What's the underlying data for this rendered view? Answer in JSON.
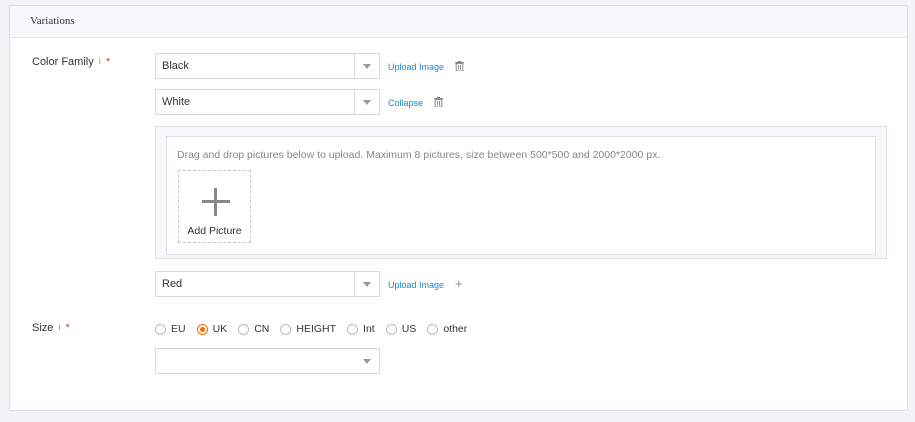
{
  "section": {
    "title": "Variations"
  },
  "color_family": {
    "label": "Color Family",
    "info_icon": "i",
    "required": "*",
    "colors": [
      {
        "value": "Black",
        "action": "Upload Image"
      },
      {
        "value": "White",
        "action": "Collapse"
      },
      {
        "value": "Red",
        "action": "Upload Image"
      }
    ],
    "upload": {
      "hint": "Drag and drop pictures below to upload. Maximum 8 pictures, size between 500*500 and 2000*2000 px.",
      "add_label": "Add Picture"
    }
  },
  "size": {
    "label": "Size",
    "info_icon": "i",
    "required": "*",
    "options": [
      "EU",
      "UK",
      "CN",
      "HEIGHT",
      "Int",
      "US",
      "other"
    ],
    "selected": "UK",
    "dropdown_value": ""
  },
  "colors": {
    "accent": "#ff6a00",
    "link": "#1a8ad6",
    "required": "#e53935"
  }
}
